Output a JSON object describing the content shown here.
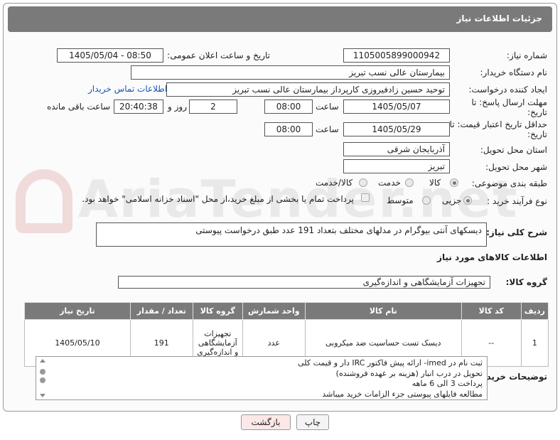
{
  "header": {
    "title": "جزئیات اطلاعات نیاز"
  },
  "watermark": "AriaTender.net",
  "need_number": {
    "label": "شماره نیاز:",
    "value": "1105005899000942"
  },
  "announce": {
    "label": "تاریخ و ساعت اعلان عمومی:",
    "value": "1405/05/04 - 08:50"
  },
  "buyer_org": {
    "label": "نام دستگاه خریدار:",
    "value": "بیمارستان عالی نسب تبریز"
  },
  "requester": {
    "label": "ایجاد کننده درخواست:",
    "value": "توحید حسین زادفیروزی کارپرداز بیمارستان عالی نسب تبریز",
    "contact_link": "اطلاعات تماس خریدار"
  },
  "deadline": {
    "label": "مهلت ارسال پاسخ: تا تاریخ:",
    "date": "1405/05/07",
    "time_label": "ساعت",
    "time": "08:00",
    "days": "2",
    "days_label": "روز و",
    "remaining": "20:40:38",
    "remaining_label": "ساعت باقی مانده"
  },
  "price_validity": {
    "label": "حداقل تاریخ اعتبار قیمت: تا تاریخ:",
    "date": "1405/05/29",
    "time_label": "ساعت",
    "time": "08:00"
  },
  "province": {
    "label": "استان محل تحویل:",
    "value": "آذربایجان شرقی"
  },
  "city": {
    "label": "شهر محل تحویل:",
    "value": "تبریز"
  },
  "category": {
    "label": "طبقه بندی موضوعی:",
    "options": [
      "کالا",
      "خدمت",
      "کالا/خدمت"
    ],
    "selected": "کالا"
  },
  "purchase_type": {
    "label": "نوع فرآیند خرید :",
    "options": [
      "جزیی",
      "متوسط"
    ],
    "selected": "جزیی",
    "payment_note": "پرداخت تمام یا بخشی از مبلغ خرید،از محل \"اسناد خزانه اسلامی\" خواهد بود."
  },
  "description": {
    "label": "شرح کلی نیاز:",
    "value": "دیسکهای آنتی بیوگرام در مدلهای مختلف بتعداد 191 عدد طبق درخواست پیوستی"
  },
  "goods_info": {
    "title": "اطلاعات کالاهای مورد نیاز"
  },
  "goods_group": {
    "label": "گروه کالا:",
    "value": "تجهیزات آزمایشگاهی و اندازه‌گیری"
  },
  "table": {
    "headers": [
      "ردیف",
      "کد کالا",
      "نام کالا",
      "واحد شمارش",
      "گروه کالا",
      "تعداد / مقدار",
      "تاریخ نیاز"
    ],
    "rows": [
      {
        "row": "1",
        "code": "--",
        "name": "دیسک تست حساسیت ضد میکروبی",
        "unit": "عدد",
        "group": "تجهیزات آزمایشگاهی و اندازه‌گیری",
        "qty": "191",
        "date": "1405/05/10"
      }
    ]
  },
  "buyer_notes": {
    "label": "توضیحات خریدار:",
    "lines": [
      "ثبت نام در imed- ارائه پیش فاکتور IRC دار و قیمت کلی",
      "تحویل در درب انبار (هزینه بر عهده فروشنده)",
      "پرداخت  3 الی 6 ماهه",
      "مطالعه فایلهای پیوستی جزء الزامات خرید میباشد"
    ]
  },
  "buttons": {
    "print": "چاپ",
    "back": "بازگشت"
  },
  "colors": {
    "header_bg": "#7a7a7a",
    "link": "#1a56b0",
    "back_button_bg": "#fde8e8"
  }
}
